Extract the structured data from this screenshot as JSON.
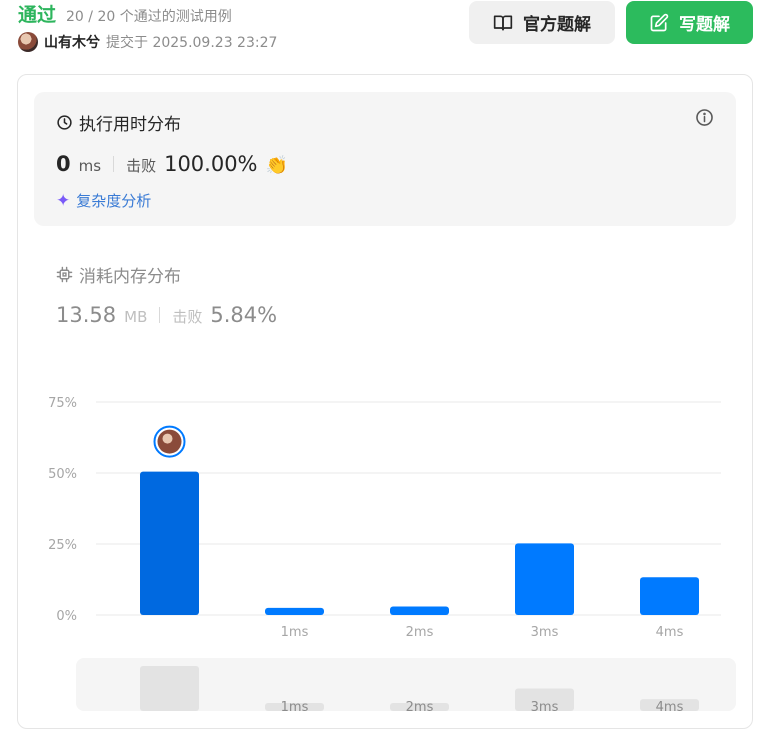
{
  "header": {
    "status": "通过",
    "cases": "20 / 20 个通过的测试用例",
    "username": "山有木兮",
    "submitted_at": "提交于 2025.09.23 23:27"
  },
  "buttons": {
    "official_solution": "官方题解",
    "write_solution": "写题解",
    "primary_color": "#2cbb5d"
  },
  "runtime": {
    "title": "执行用时分布",
    "value": "0",
    "unit": "ms",
    "beat_label": "击败",
    "beat_value": "100.00%",
    "complexity_link": "复杂度分析"
  },
  "memory": {
    "title": "消耗内存分布",
    "value": "13.58",
    "unit": "MB",
    "beat_label": "击败",
    "beat_value": "5.84%"
  },
  "chart_data": {
    "type": "bar",
    "categories": [
      "",
      "1ms",
      "2ms",
      "3ms",
      "4ms"
    ],
    "values": [
      50.5,
      2.5,
      3.0,
      25.2,
      13.3
    ],
    "highlight_index": 0,
    "yticks": [
      "0%",
      "25%",
      "50%",
      "75%"
    ],
    "ylim": [
      0,
      75
    ],
    "grid": true,
    "bar_color": "#007aff",
    "highlight_color": "#0069e0"
  }
}
